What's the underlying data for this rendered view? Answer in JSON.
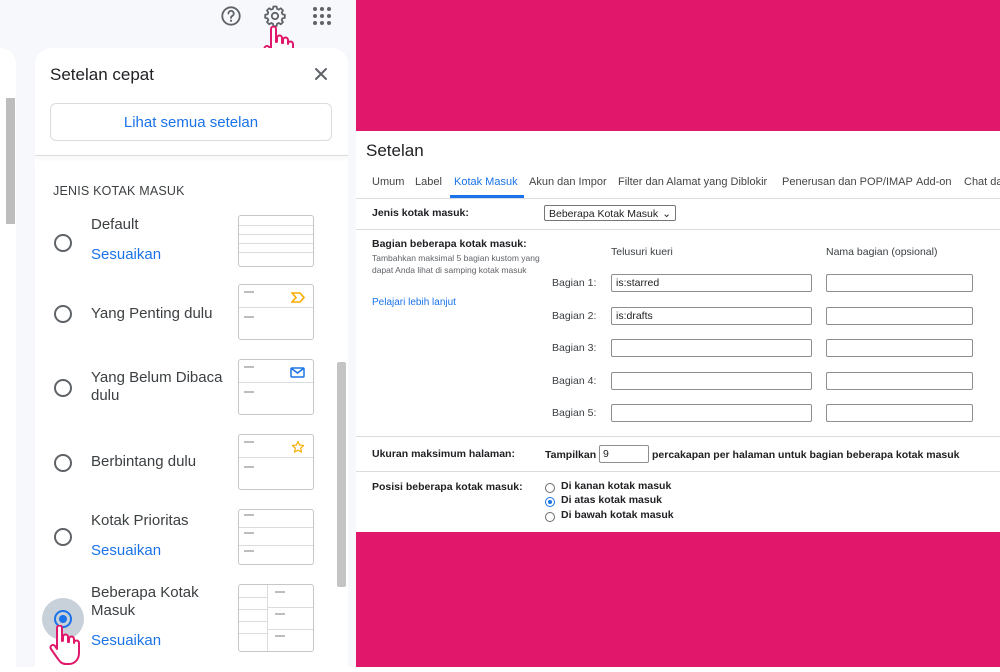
{
  "top_bar": {
    "icons": [
      "help-icon",
      "gear-icon",
      "apps-grid-icon"
    ]
  },
  "quick_settings": {
    "title": "Setelan cepat",
    "see_all_button": "Lihat semua setelan",
    "section_title": "JENIS KOTAK MASUK",
    "options": [
      {
        "label": "Default",
        "link": "Sesuaikan",
        "selected": false
      },
      {
        "label": "Yang Penting dulu",
        "link": "",
        "selected": false
      },
      {
        "label": "Yang Belum Dibaca dulu",
        "link": "",
        "selected": false
      },
      {
        "label": "Berbintang dulu",
        "link": "",
        "selected": false
      },
      {
        "label": "Kotak Prioritas",
        "link": "Sesuaikan",
        "selected": false
      },
      {
        "label": "Beberapa Kotak Masuk",
        "link": "Sesuaikan",
        "selected": true
      }
    ]
  },
  "settings": {
    "title": "Setelan",
    "tabs": [
      "Umum",
      "Label",
      "Kotak Masuk",
      "Akun dan Impor",
      "Filter dan Alamat yang Diblokir",
      "Penerusan dan POP/IMAP",
      "Add-on",
      "Chat da"
    ],
    "active_tab": "Kotak Masuk",
    "inbox_type_label": "Jenis kotak masuk:",
    "inbox_type_value": "Beberapa Kotak Masuk",
    "multi_sections_label": "Bagian beberapa kotak masuk:",
    "multi_sections_help": "Tambahkan maksimal 5 bagian kustom yang dapat Anda lihat di samping kotak masuk",
    "learn_more": "Pelajari lebih lanjut",
    "col_query": "Telusuri kueri",
    "col_name": "Nama bagian (opsional)",
    "sections": [
      {
        "label": "Bagian 1:",
        "query": "is:starred",
        "name": ""
      },
      {
        "label": "Bagian 2:",
        "query": "is:drafts",
        "name": ""
      },
      {
        "label": "Bagian 3:",
        "query": "",
        "name": ""
      },
      {
        "label": "Bagian 4:",
        "query": "",
        "name": ""
      },
      {
        "label": "Bagian 5:",
        "query": "",
        "name": ""
      }
    ],
    "max_page_label": "Ukuran maksimum halaman:",
    "show_label": "Tampilkan",
    "page_size": "9",
    "page_suffix": "percakapan per halaman untuk bagian beberapa kotak masuk",
    "position_label": "Posisi beberapa kotak masuk:",
    "positions": [
      {
        "label": "Di kanan kotak masuk",
        "selected": false
      },
      {
        "label": "Di atas kotak masuk",
        "selected": true
      },
      {
        "label": "Di bawah kotak masuk",
        "selected": false
      }
    ]
  },
  "colors": {
    "accent": "#1a73e8",
    "pink_background": "#e0176a",
    "important_marker": "#f9ab00",
    "star": "#f9ab00"
  }
}
